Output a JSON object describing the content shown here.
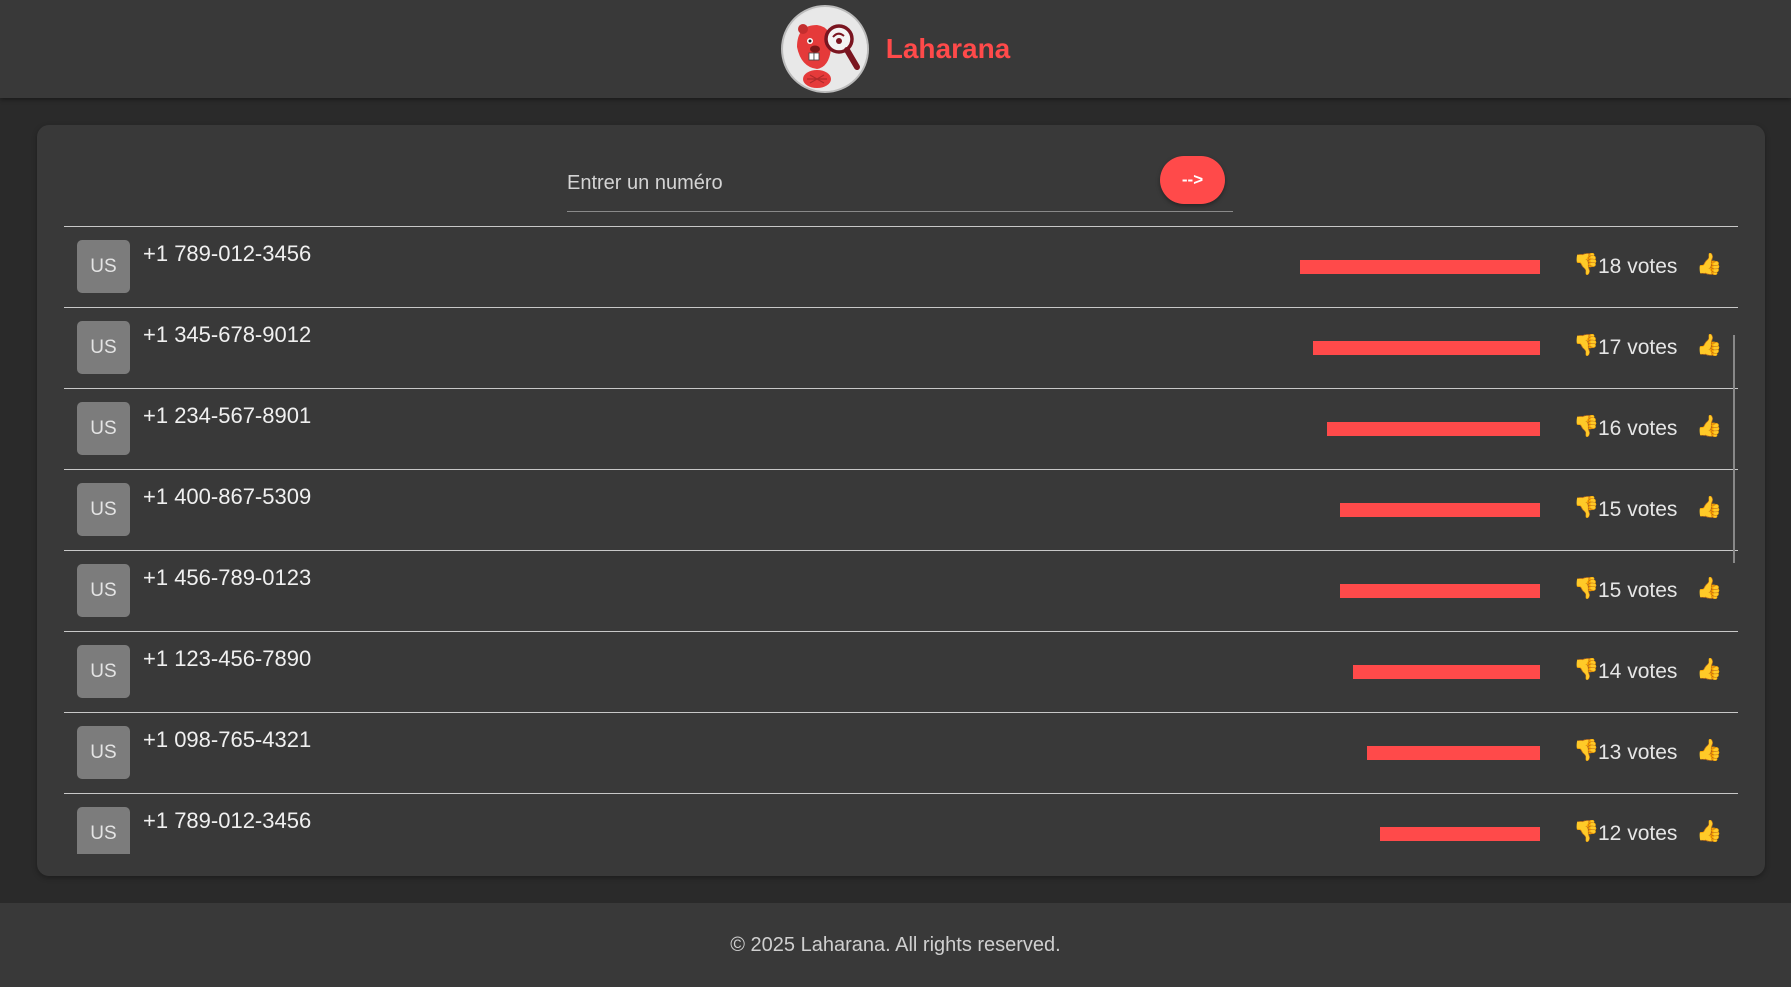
{
  "header": {
    "brand": "Laharana",
    "logo_icon": "beaver-magnifier-logo-icon"
  },
  "search": {
    "placeholder": "Entrer un numéro",
    "value": "",
    "submit_label": "-->"
  },
  "colors": {
    "accent": "#ff4a4a",
    "thumb": "#f5c542",
    "background": "#2a2a2a",
    "card": "#393939"
  },
  "vote_icons": {
    "down": "thumbs-down-icon",
    "up": "thumbs-up-icon"
  },
  "rows": [
    {
      "country": "US",
      "phone": "+1 789-012-3456",
      "votes": 18,
      "votes_label": "18 votes"
    },
    {
      "country": "US",
      "phone": "+1 345-678-9012",
      "votes": 17,
      "votes_label": "17 votes"
    },
    {
      "country": "US",
      "phone": "+1 234-567-8901",
      "votes": 16,
      "votes_label": "16 votes"
    },
    {
      "country": "US",
      "phone": "+1 400-867-5309",
      "votes": 15,
      "votes_label": "15 votes"
    },
    {
      "country": "US",
      "phone": "+1 456-789-0123",
      "votes": 15,
      "votes_label": "15 votes"
    },
    {
      "country": "US",
      "phone": "+1 123-456-7890",
      "votes": 14,
      "votes_label": "14 votes"
    },
    {
      "country": "US",
      "phone": "+1 098-765-4321",
      "votes": 13,
      "votes_label": "13 votes"
    },
    {
      "country": "US",
      "phone": "+1 789-012-3456",
      "votes": 12,
      "votes_label": "12 votes"
    }
  ],
  "footer": {
    "text": "© 2025 Laharana. All rights reserved."
  }
}
